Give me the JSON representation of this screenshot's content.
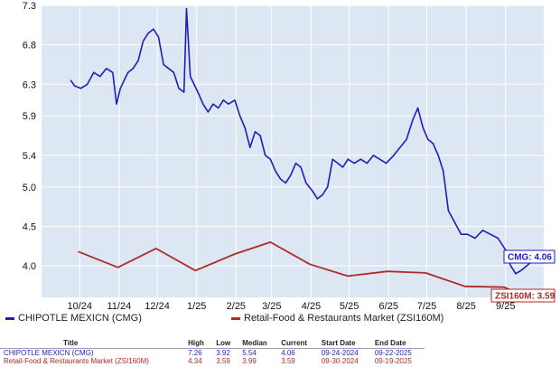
{
  "chart_data": {
    "type": "line",
    "ylim": [
      3.6,
      7.3
    ],
    "y_ticks": [
      "7.3",
      "6.8",
      "6.3",
      "5.9",
      "5.4",
      "5.0",
      "4.5",
      "4.0"
    ],
    "y_tick_values": [
      7.3,
      6.8,
      6.3,
      5.9,
      5.4,
      5.0,
      4.5,
      4.0
    ],
    "x_ticks": [
      "10/24",
      "11/24",
      "12/24",
      "1/25",
      "2/25",
      "3/25",
      "4/25",
      "5/25",
      "6/25",
      "7/25",
      "8/25",
      "9/25"
    ],
    "x_tick_dates": [
      "2024-10-01",
      "2024-11-01",
      "2024-12-01",
      "2025-01-01",
      "2025-02-01",
      "2025-03-01",
      "2025-04-01",
      "2025-05-01",
      "2025-06-01",
      "2025-07-01",
      "2025-08-01",
      "2025-09-01"
    ],
    "grid": true,
    "series": [
      {
        "name": "CHIPOTLE MEXICN (CMG)",
        "color": "#1f1fb8",
        "callout": "CMG: 4.06",
        "points": [
          [
            "2024-09-24",
            6.35
          ],
          [
            "2024-09-27",
            6.28
          ],
          [
            "2024-10-02",
            6.25
          ],
          [
            "2024-10-07",
            6.3
          ],
          [
            "2024-10-12",
            6.45
          ],
          [
            "2024-10-17",
            6.4
          ],
          [
            "2024-10-22",
            6.5
          ],
          [
            "2024-10-27",
            6.45
          ],
          [
            "2024-10-30",
            6.05
          ],
          [
            "2024-11-02",
            6.25
          ],
          [
            "2024-11-05",
            6.35
          ],
          [
            "2024-11-08",
            6.45
          ],
          [
            "2024-11-12",
            6.5
          ],
          [
            "2024-11-16",
            6.6
          ],
          [
            "2024-11-20",
            6.85
          ],
          [
            "2024-11-24",
            6.95
          ],
          [
            "2024-11-28",
            7.0
          ],
          [
            "2024-12-02",
            6.9
          ],
          [
            "2024-12-06",
            6.55
          ],
          [
            "2024-12-10",
            6.5
          ],
          [
            "2024-12-14",
            6.45
          ],
          [
            "2024-12-18",
            6.25
          ],
          [
            "2024-12-22",
            6.2
          ],
          [
            "2024-12-24",
            7.26
          ],
          [
            "2024-12-27",
            6.4
          ],
          [
            "2025-01-02",
            6.2
          ],
          [
            "2025-01-06",
            6.05
          ],
          [
            "2025-01-10",
            5.95
          ],
          [
            "2025-01-14",
            6.05
          ],
          [
            "2025-01-18",
            6.0
          ],
          [
            "2025-01-22",
            6.1
          ],
          [
            "2025-01-26",
            6.05
          ],
          [
            "2025-01-31",
            6.1
          ],
          [
            "2025-02-04",
            5.9
          ],
          [
            "2025-02-08",
            5.75
          ],
          [
            "2025-02-12",
            5.5
          ],
          [
            "2025-02-16",
            5.7
          ],
          [
            "2025-02-20",
            5.65
          ],
          [
            "2025-02-24",
            5.4
          ],
          [
            "2025-02-28",
            5.35
          ],
          [
            "2025-03-04",
            5.2
          ],
          [
            "2025-03-08",
            5.1
          ],
          [
            "2025-03-12",
            5.05
          ],
          [
            "2025-03-16",
            5.15
          ],
          [
            "2025-03-20",
            5.3
          ],
          [
            "2025-03-24",
            5.25
          ],
          [
            "2025-03-28",
            5.05
          ],
          [
            "2025-04-02",
            4.95
          ],
          [
            "2025-04-06",
            4.85
          ],
          [
            "2025-04-10",
            4.9
          ],
          [
            "2025-04-14",
            5.0
          ],
          [
            "2025-04-18",
            5.35
          ],
          [
            "2025-04-22",
            5.3
          ],
          [
            "2025-04-26",
            5.25
          ],
          [
            "2025-04-30",
            5.35
          ],
          [
            "2025-05-05",
            5.3
          ],
          [
            "2025-05-10",
            5.35
          ],
          [
            "2025-05-15",
            5.3
          ],
          [
            "2025-05-20",
            5.4
          ],
          [
            "2025-05-25",
            5.35
          ],
          [
            "2025-05-30",
            5.3
          ],
          [
            "2025-06-05",
            5.4
          ],
          [
            "2025-06-10",
            5.5
          ],
          [
            "2025-06-15",
            5.6
          ],
          [
            "2025-06-20",
            5.85
          ],
          [
            "2025-06-24",
            6.0
          ],
          [
            "2025-06-28",
            5.75
          ],
          [
            "2025-07-02",
            5.6
          ],
          [
            "2025-07-06",
            5.55
          ],
          [
            "2025-07-10",
            5.4
          ],
          [
            "2025-07-14",
            5.2
          ],
          [
            "2025-07-18",
            4.7
          ],
          [
            "2025-07-23",
            4.55
          ],
          [
            "2025-07-28",
            4.4
          ],
          [
            "2025-08-02",
            4.4
          ],
          [
            "2025-08-08",
            4.35
          ],
          [
            "2025-08-14",
            4.45
          ],
          [
            "2025-08-20",
            4.4
          ],
          [
            "2025-08-26",
            4.35
          ],
          [
            "2025-09-01",
            4.2
          ],
          [
            "2025-09-05",
            4.0
          ],
          [
            "2025-09-09",
            3.9
          ],
          [
            "2025-09-14",
            3.95
          ],
          [
            "2025-09-22",
            4.06
          ]
        ]
      },
      {
        "name": "Retail-Food & Restaurants Market (ZSI160M)",
        "color": "#b02a2a",
        "callout": "ZSI160M: 3.59",
        "points": [
          [
            "2024-09-30",
            4.18
          ],
          [
            "2024-10-31",
            3.98
          ],
          [
            "2024-11-30",
            4.22
          ],
          [
            "2024-12-31",
            3.94
          ],
          [
            "2025-01-31",
            4.15
          ],
          [
            "2025-02-28",
            4.3
          ],
          [
            "2025-03-31",
            4.02
          ],
          [
            "2025-04-30",
            3.87
          ],
          [
            "2025-05-31",
            3.93
          ],
          [
            "2025-06-30",
            3.91
          ],
          [
            "2025-07-31",
            3.74
          ],
          [
            "2025-08-31",
            3.73
          ],
          [
            "2025-09-19",
            3.59
          ]
        ]
      }
    ]
  },
  "stats_table": {
    "headers": [
      "Title",
      "High",
      "Low",
      "Median",
      "Current",
      "Start Date",
      "End Date"
    ],
    "rows": [
      {
        "title": "CHIPOTLE MEXICN (CMG)",
        "high": "7.26",
        "low": "3.92",
        "median": "5.54",
        "current": "4.06",
        "start": "09-24-2024",
        "end": "09-22-2025"
      },
      {
        "title": "Retail-Food & Restaurants Market (ZSI160M)",
        "high": "4.34",
        "low": "3.59",
        "median": "3.99",
        "current": "3.59",
        "start": "09-30-2024",
        "end": "09-19-2025"
      }
    ]
  }
}
